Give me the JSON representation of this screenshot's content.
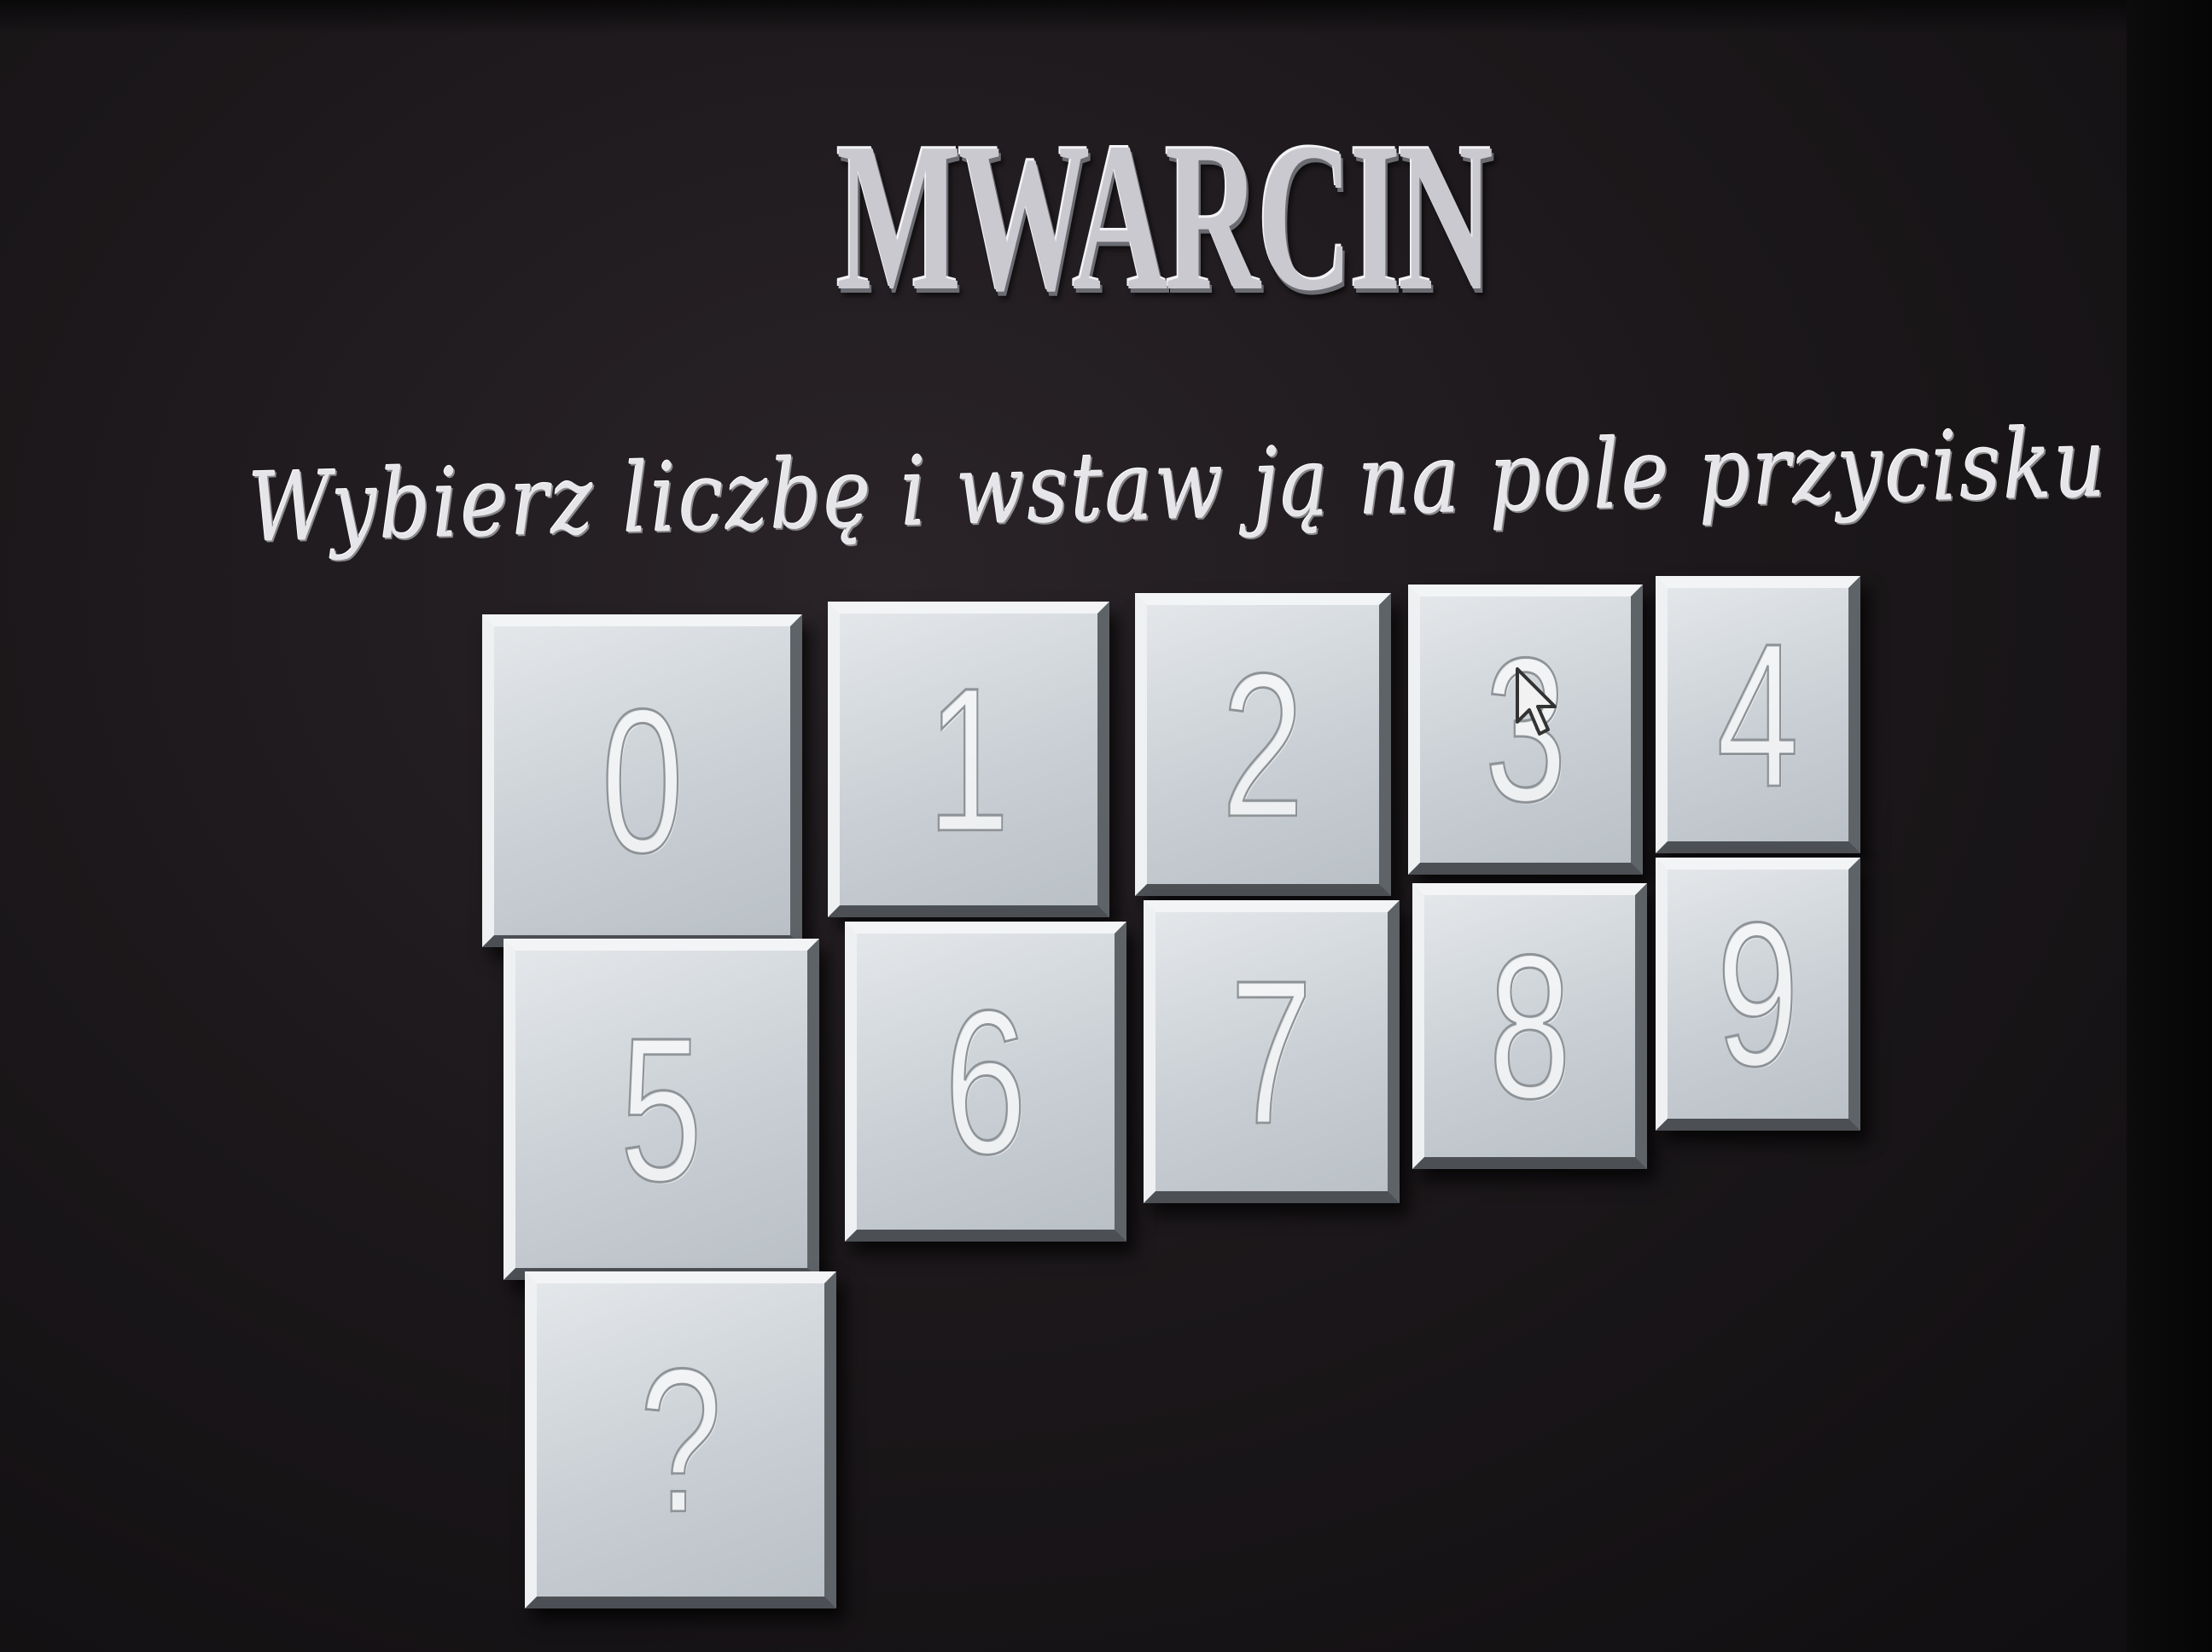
{
  "app": {
    "title": "MWARCIN",
    "instruction": "Wybierz liczbę i wstaw ją na pole przycisku"
  },
  "keypad": {
    "keys": [
      {
        "label": "0"
      },
      {
        "label": "1"
      },
      {
        "label": "2"
      },
      {
        "label": "3"
      },
      {
        "label": "4"
      },
      {
        "label": "5"
      },
      {
        "label": "6"
      },
      {
        "label": "7"
      },
      {
        "label": "8"
      },
      {
        "label": "9"
      },
      {
        "label": "?"
      }
    ]
  },
  "colors": {
    "background": "#1c181b",
    "key_face": "#c9cfd4",
    "title_text": "#c9c9cf"
  },
  "icons": {
    "cursor": "mouse-pointer-icon"
  }
}
